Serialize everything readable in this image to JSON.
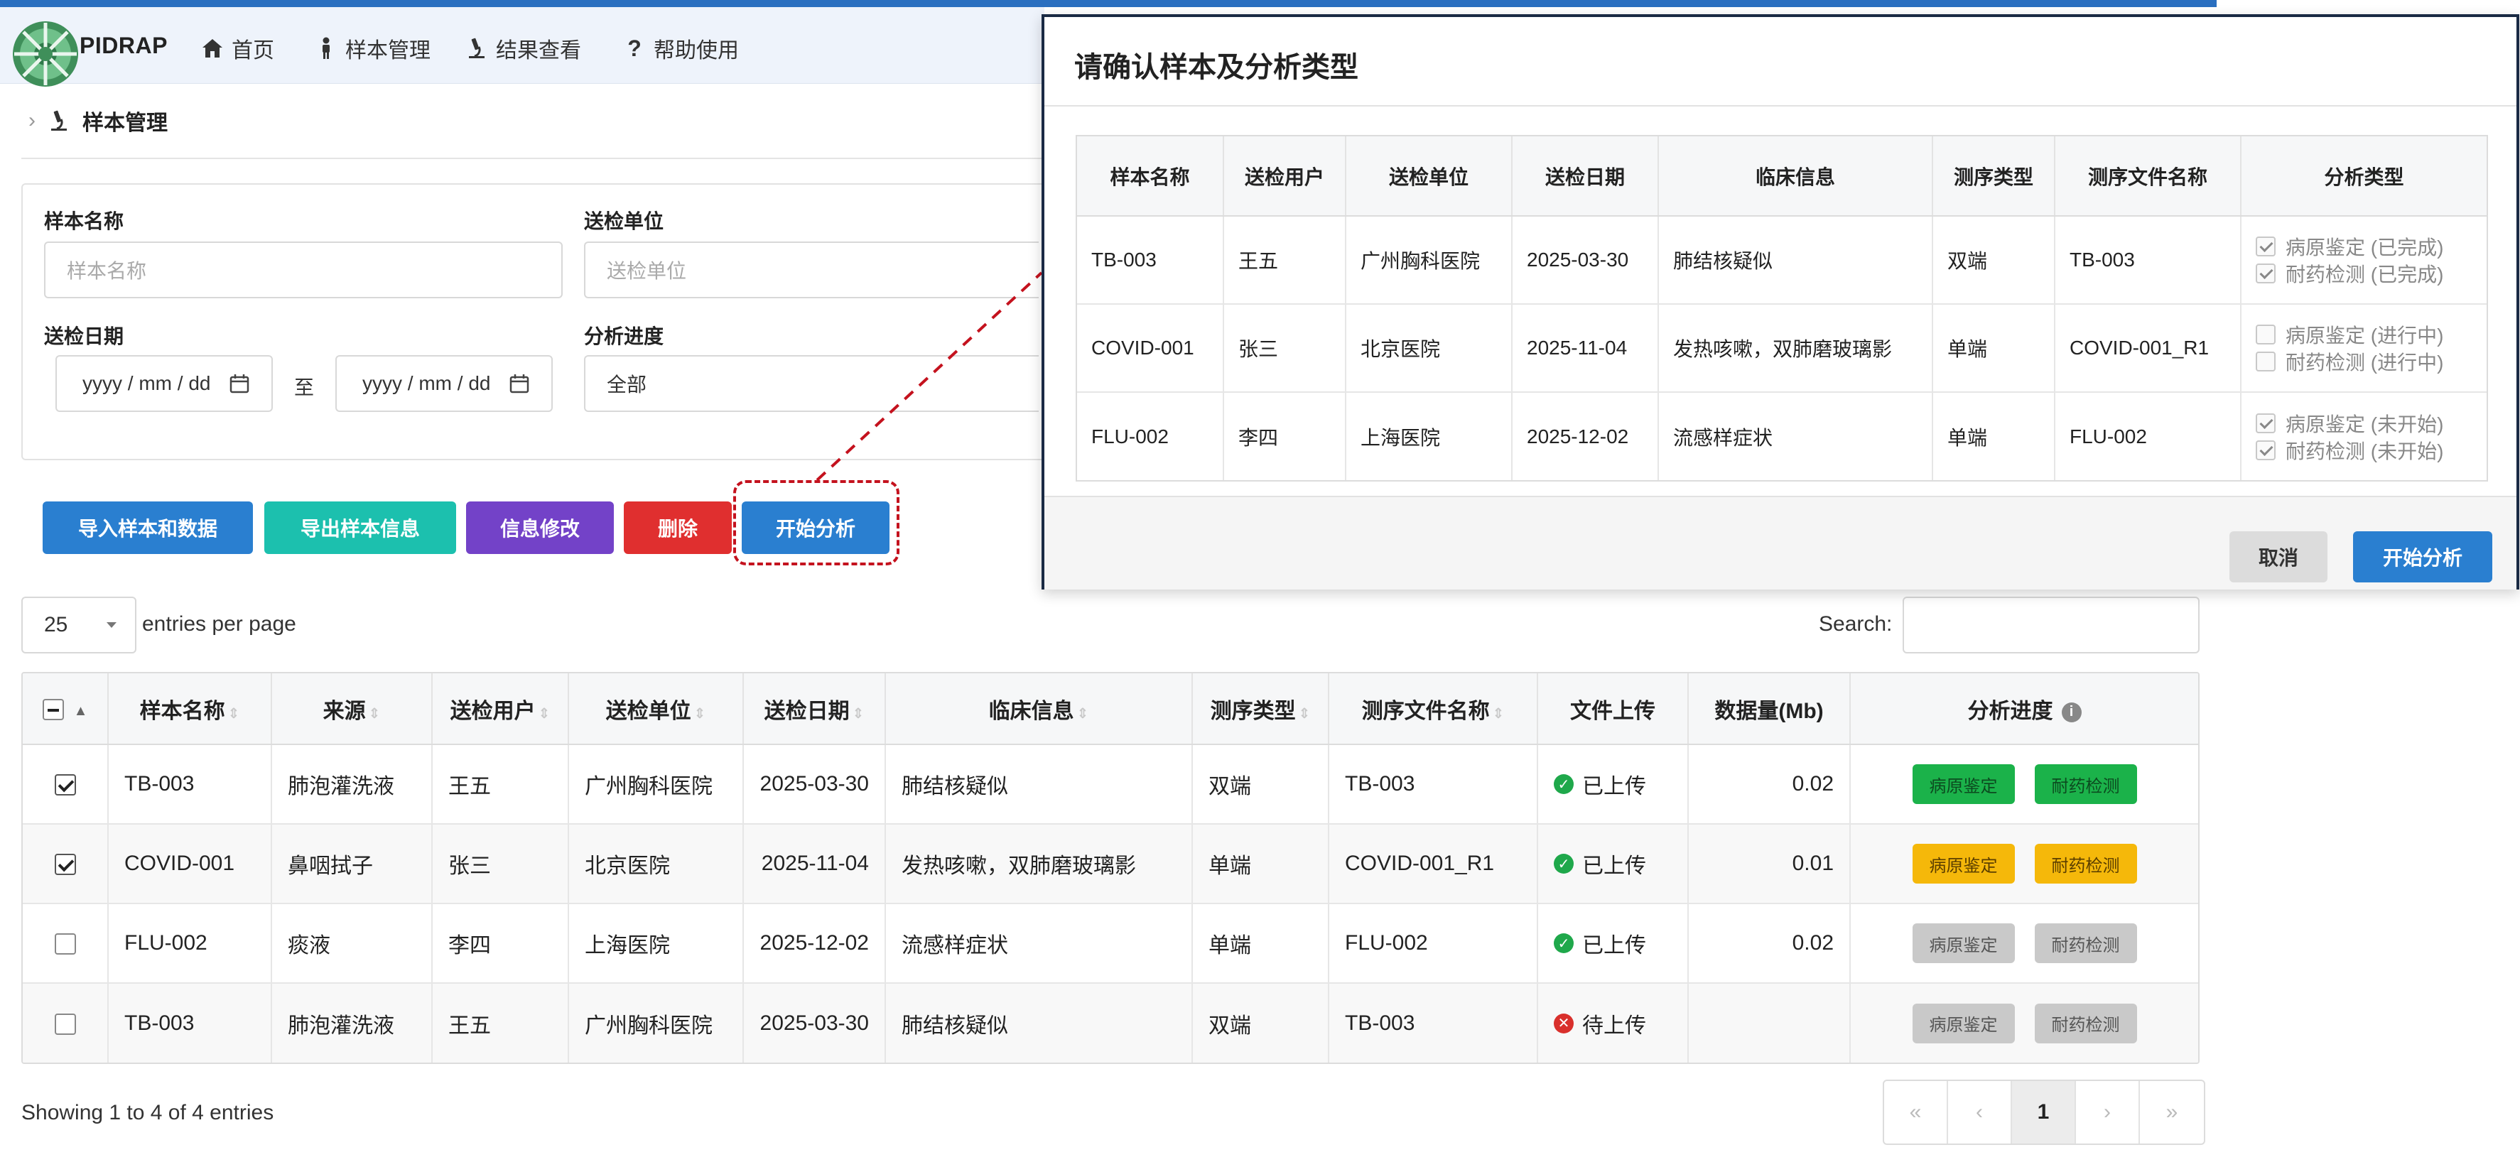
{
  "nav": {
    "brand": "PIDRAP",
    "items": [
      {
        "label": "首页",
        "icon": "home-icon"
      },
      {
        "label": "样本管理",
        "icon": "person-icon"
      },
      {
        "label": "结果查看",
        "icon": "microscope-icon"
      },
      {
        "label": "帮助使用",
        "icon": "question-icon"
      }
    ]
  },
  "breadcrumb": {
    "current": "样本管理"
  },
  "filter": {
    "sample_name_label": "样本名称",
    "sample_name_placeholder": "样本名称",
    "unit_label": "送检单位",
    "unit_placeholder": "送检单位",
    "date_label": "送检日期",
    "date_from": "yyyy / mm / dd",
    "date_to": "yyyy / mm / dd",
    "to_text": "至",
    "progress_label": "分析进度",
    "progress_value": "全部"
  },
  "actions": {
    "import": "导入样本和数据",
    "export": "导出样本信息",
    "edit": "信息修改",
    "delete": "删除",
    "start": "开始分析"
  },
  "list": {
    "entries_value": "25",
    "entries_label": "entries per page",
    "search_label": "Search:",
    "headers": [
      "样本名称",
      "来源",
      "送检用户",
      "送检单位",
      "送检日期",
      "临床信息",
      "测序类型",
      "测序文件名称",
      "文件上传",
      "数据量(Mb)",
      "分析进度"
    ],
    "rows": [
      {
        "checked": true,
        "name": "TB-003",
        "source": "肺泡灌洗液",
        "user": "王五",
        "unit": "广州胸科医院",
        "date": "2025-03-30",
        "clinical": "肺结核疑似",
        "seq_type": "双端",
        "file": "TB-003",
        "upload": "已上传",
        "uploaded": true,
        "size": "0.02",
        "tag1": "病原鉴定",
        "tag2": "耐药检测",
        "tag_color": "#1bb24a"
      },
      {
        "checked": true,
        "name": "COVID-001",
        "source": "鼻咽拭子",
        "user": "张三",
        "unit": "北京医院",
        "date": "2025-11-04",
        "clinical": "发热咳嗽，双肺磨玻璃影",
        "seq_type": "单端",
        "file": "COVID-001_R1",
        "upload": "已上传",
        "uploaded": true,
        "size": "0.01",
        "tag1": "病原鉴定",
        "tag2": "耐药检测",
        "tag_color": "#f5b80a"
      },
      {
        "checked": false,
        "name": "FLU-002",
        "source": "痰液",
        "user": "李四",
        "unit": "上海医院",
        "date": "2025-12-02",
        "clinical": "流感样症状",
        "seq_type": "单端",
        "file": "FLU-002",
        "upload": "已上传",
        "uploaded": true,
        "size": "0.02",
        "tag1": "病原鉴定",
        "tag2": "耐药检测",
        "tag_color": "#c9c9c9"
      },
      {
        "checked": false,
        "name": "TB-003",
        "source": "肺泡灌洗液",
        "user": "王五",
        "unit": "广州胸科医院",
        "date": "2025-03-30",
        "clinical": "肺结核疑似",
        "seq_type": "双端",
        "file": "TB-003",
        "upload": "待上传",
        "uploaded": false,
        "size": "",
        "tag1": "病原鉴定",
        "tag2": "耐药检测",
        "tag_color": "#c9c9c9"
      }
    ],
    "showing": "Showing 1 to 4 of 4 entries",
    "pager": [
      "«",
      "‹",
      "1",
      "›",
      "»"
    ]
  },
  "modal": {
    "title": "请确认样本及分析类型",
    "headers": [
      "样本名称",
      "送检用户",
      "送检单位",
      "送检日期",
      "临床信息",
      "测序类型",
      "测序文件名称",
      "分析类型"
    ],
    "rows": [
      {
        "name": "TB-003",
        "user": "王五",
        "unit": "广州胸科医院",
        "date": "2025-03-30",
        "clinical": "肺结核疑似",
        "seq_type": "双端",
        "file": "TB-003",
        "opt1": "病原鉴定 (已完成)",
        "opt2": "耐药检测 (已完成)",
        "checked": true
      },
      {
        "name": "COVID-001",
        "user": "张三",
        "unit": "北京医院",
        "date": "2025-11-04",
        "clinical": "发热咳嗽，双肺磨玻璃影",
        "seq_type": "单端",
        "file": "COVID-001_R1",
        "opt1": "病原鉴定 (进行中)",
        "opt2": "耐药检测 (进行中)",
        "checked": false
      },
      {
        "name": "FLU-002",
        "user": "李四",
        "unit": "上海医院",
        "date": "2025-12-02",
        "clinical": "流感样症状",
        "seq_type": "单端",
        "file": "FLU-002",
        "opt1": "病原鉴定 (未开始)",
        "opt2": "耐药检测 (未开始)",
        "checked": true
      }
    ],
    "cancel": "取消",
    "start": "开始分析"
  }
}
